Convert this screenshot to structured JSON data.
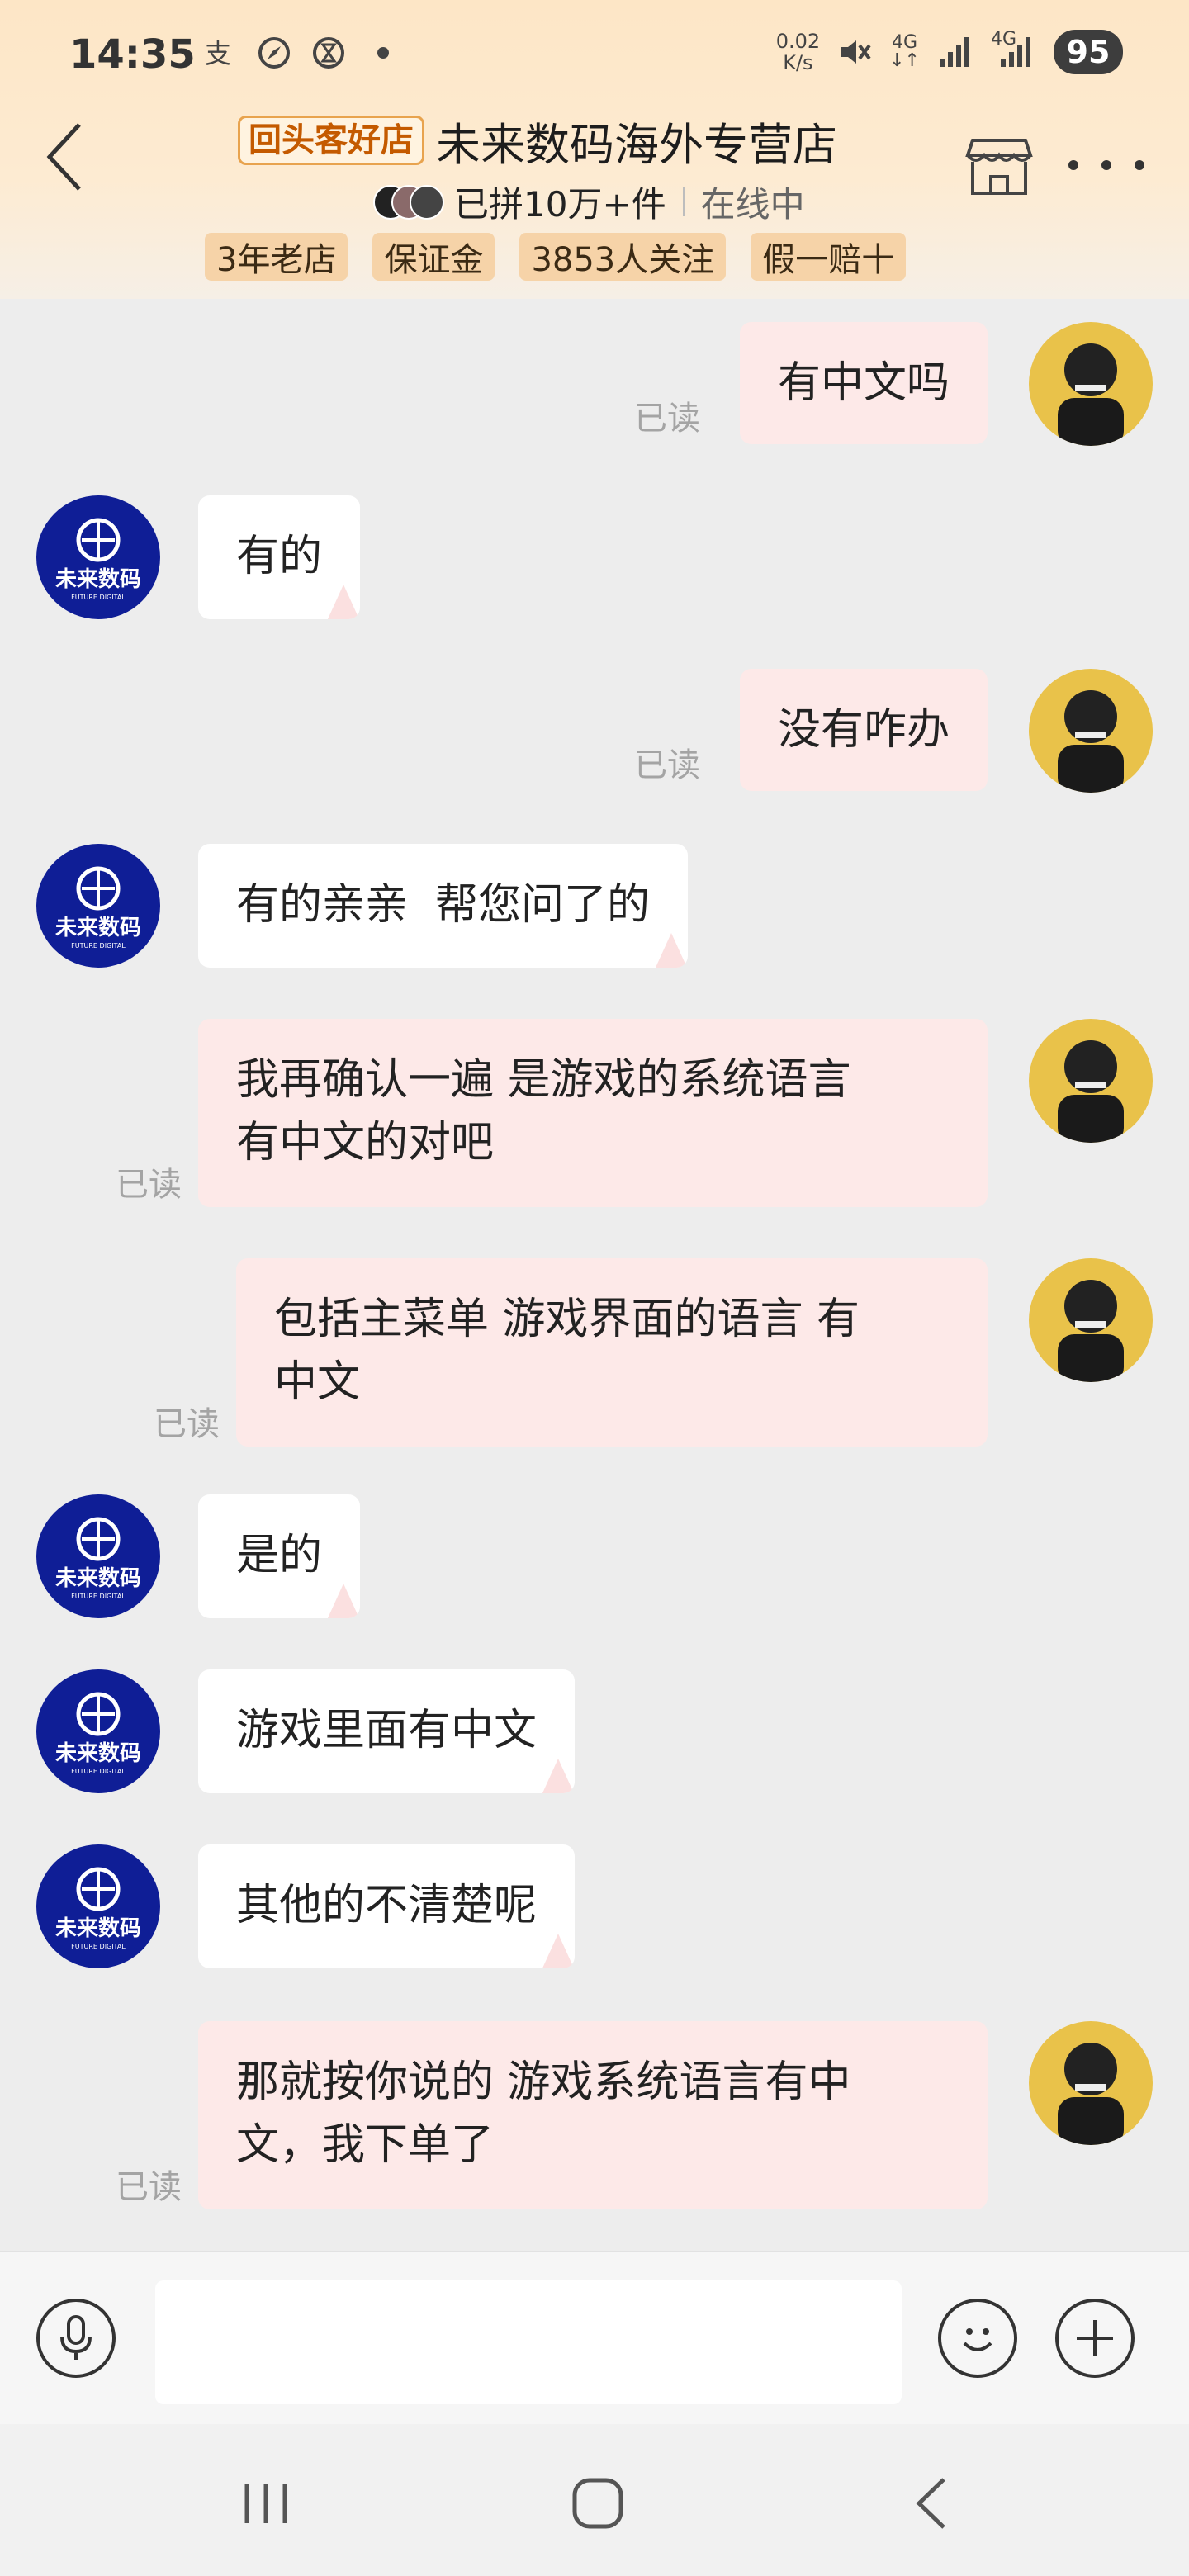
{
  "status_bar": {
    "time": "14:35",
    "net_speed_value": "0.02",
    "net_speed_unit": "K/s",
    "signal_1_label": "4G",
    "signal_2_label": "4G",
    "battery": "95"
  },
  "header": {
    "shop_tag": "回头客好店",
    "shop_name": "未来数码海外专营店",
    "sold": "已拼10万+件",
    "online": "在线中",
    "tags": [
      "3年老店",
      "保证金",
      "3853人关注",
      "假一赔十"
    ]
  },
  "messages": [
    {
      "side": "out",
      "lines": [
        "有中文吗"
      ],
      "read": "已读"
    },
    {
      "side": "in",
      "lines": [
        "有的"
      ]
    },
    {
      "side": "out",
      "lines": [
        "没有咋办"
      ],
      "read": "已读"
    },
    {
      "side": "in",
      "lines": [
        "有的亲亲  帮您问了的"
      ]
    },
    {
      "side": "out",
      "lines": [
        "我再确认一遍 是游戏的系统语言",
        "有中文的对吧"
      ],
      "read": "已读"
    },
    {
      "side": "out",
      "lines": [
        "包括主菜单 游戏界面的语言 有",
        "中文"
      ],
      "read": "已读"
    },
    {
      "side": "in",
      "lines": [
        "是的"
      ]
    },
    {
      "side": "in",
      "lines": [
        "游戏里面有中文"
      ]
    },
    {
      "side": "in",
      "lines": [
        "其他的不清楚呢"
      ]
    },
    {
      "side": "out",
      "lines": [
        "那就按你说的 游戏系统语言有中",
        "文，我下单了"
      ],
      "read": "已读"
    }
  ],
  "shop_avatar_text": "未来数码",
  "shop_avatar_subtext": "FUTURE DIGITAL",
  "input": {
    "placeholder": ""
  },
  "icons": {
    "back": "chevron-left-icon",
    "store": "store-icon",
    "more": "more-dots-icon",
    "voice": "microphone-icon",
    "emoji": "smiley-icon",
    "add": "plus-icon"
  },
  "colors": {
    "header_bg": "#fde6c6",
    "chat_bg": "#ededed",
    "outgoing_bubble": "#fde9e8",
    "incoming_bubble": "#ffffff",
    "tag_bg": "#f6d3a8",
    "shop_avatar": "#0f1e96",
    "user_avatar": "#e9c24a"
  }
}
